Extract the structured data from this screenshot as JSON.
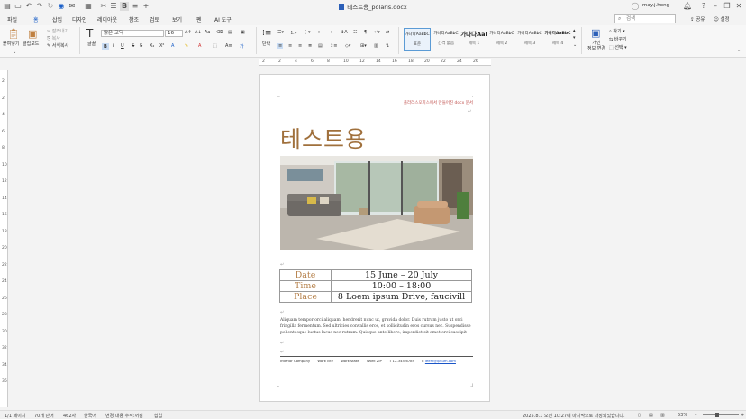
{
  "window": {
    "title": "테스트용_polaris.docx",
    "user": "may.j.hong"
  },
  "menu": {
    "tabs": [
      "파일",
      "홈",
      "삽입",
      "디자인",
      "레이아웃",
      "참조",
      "검토",
      "보기",
      "펜",
      "AI 도구"
    ],
    "active_tab": "홈",
    "search_placeholder": "검색",
    "share_label": "공유",
    "settings_label": "설정"
  },
  "ribbon": {
    "paste_label": "붙여넣기",
    "clipboard_label": "클립보드",
    "cut_label": "잘라내기",
    "copy_label": "복사",
    "format_copy_label": "서식복사",
    "font_group_label": "글꼴",
    "font_name": "맑은 고딕",
    "font_size": "16",
    "paragraph_label": "단락",
    "styles": [
      {
        "preview": "가나다AaBbC",
        "name": "표준"
      },
      {
        "preview": "가나다AaBbC",
        "name": "간격 없음"
      },
      {
        "preview": "가나다Aal",
        "name": "제목 1"
      },
      {
        "preview": "가나다AaBbC",
        "name": "제목 2"
      },
      {
        "preview": "가나다AaBbC",
        "name": "제목 3"
      },
      {
        "preview": "가나다AaBbC",
        "name": "제목 4"
      }
    ],
    "personal_info_label": "개인\n정보 변경",
    "find_label": "찾기",
    "replace_label": "바꾸기",
    "select_label": "선택"
  },
  "ruler": {
    "h_ticks": [
      "2",
      "2",
      "4",
      "6",
      "8",
      "10",
      "12",
      "14",
      "16",
      "18",
      "20",
      "22",
      "24",
      "26"
    ],
    "v_ticks": [
      "2",
      "2",
      "4",
      "6",
      "8",
      "10",
      "12",
      "14",
      "16",
      "18",
      "20",
      "22",
      "24",
      "26",
      "28",
      "30",
      "32",
      "34",
      "36"
    ]
  },
  "document": {
    "header_note": "폴라리스오피스에서 만들어진 docx 문서",
    "heading": "테스트용",
    "table": [
      {
        "key": "Date",
        "value": "15 June – 20 July"
      },
      {
        "key": "Time",
        "value": "10:00 – 18:00"
      },
      {
        "key": "Place",
        "value": "8 Loem ipsum Drive, faucivill"
      }
    ],
    "body": "Aliquam tempor orci aliquam, hendrerit nunc ut, gravida dolor. Duis rutrum justo ut orci fringilla fermentum. Sed ultricies convallis eros, et sollicitudin eros cursus nec. Suspendisse pellentesque luctus lacus nec rutrum. Quisque ante libero, imperdiet sit amet orci suscipit",
    "footer": {
      "company": "Interior Company",
      "city": "Work city",
      "state": "Work state",
      "zip": "Work ZIP",
      "phone": "T 12-345-6789",
      "email_prefix": "E",
      "email": "leem@ipsum.com"
    }
  },
  "status": {
    "page": "1/1 페이지",
    "words": "70개 단어",
    "chars": "462자",
    "lang": "한국어",
    "track": "변경 내용 추적:꺼짐",
    "mode": "삽입",
    "saved": "2025.8.1 오전 10:27에 마지막으로 저장되었습니다.",
    "zoom": "53%"
  }
}
